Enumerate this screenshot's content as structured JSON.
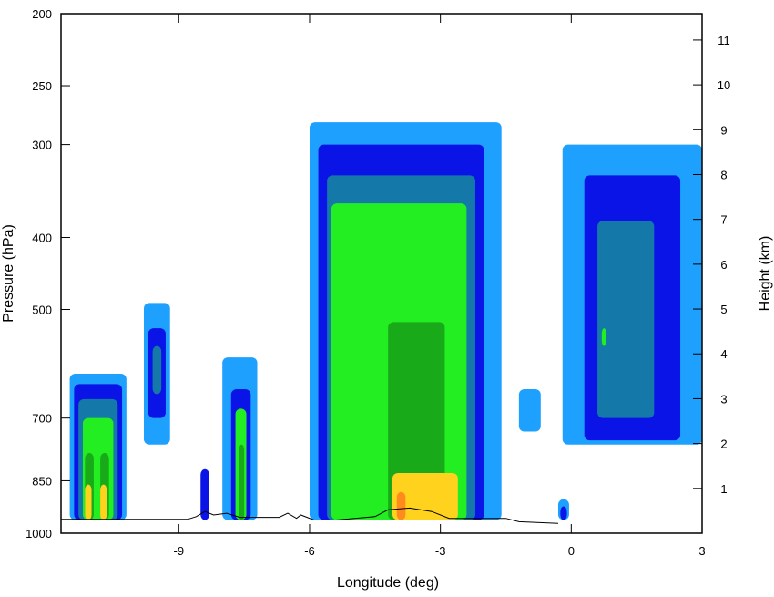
{
  "chart_data": {
    "type": "heatmap",
    "title": "",
    "xlabel": "Longitude (deg)",
    "ylabel": "Pressure (hPa)",
    "ylabel_right": "Height (km)",
    "xlim": [
      -11.7,
      3.0
    ],
    "ylim_pressure": [
      1000,
      200
    ],
    "y_scale": "log",
    "grid": false,
    "x_ticks": [
      {
        "value": -9,
        "label": "-9"
      },
      {
        "value": -6,
        "label": "-6"
      },
      {
        "value": -3,
        "label": "-3"
      },
      {
        "value": 0,
        "label": "0"
      },
      {
        "value": 3,
        "label": "3"
      }
    ],
    "y_ticks": [
      {
        "value": 200,
        "label": "200"
      },
      {
        "value": 250,
        "label": "250"
      },
      {
        "value": 300,
        "label": "300"
      },
      {
        "value": 400,
        "label": "400"
      },
      {
        "value": 500,
        "label": "500"
      },
      {
        "value": 700,
        "label": "700"
      },
      {
        "value": 850,
        "label": "850"
      },
      {
        "value": 1000,
        "label": "1000"
      }
    ],
    "height_ticks": [
      {
        "value": 1,
        "label": "1"
      },
      {
        "value": 2,
        "label": "2"
      },
      {
        "value": 3,
        "label": "3"
      },
      {
        "value": 4,
        "label": "4"
      },
      {
        "value": 5,
        "label": "5"
      },
      {
        "value": 6,
        "label": "6"
      },
      {
        "value": 7,
        "label": "7"
      },
      {
        "value": 8,
        "label": "8"
      },
      {
        "value": 9,
        "label": "9"
      },
      {
        "value": 10,
        "label": "10"
      },
      {
        "value": 11,
        "label": "11"
      }
    ],
    "colors": {
      "level1": "#1ea0ff",
      "level2": "#0a14e6",
      "level3": "#1478a8",
      "level4": "#22ee22",
      "level5": "#18aa18",
      "level6": "#ffd21e",
      "level7": "#ff8a1e",
      "terrain_line": "#000000"
    },
    "cells": [
      {
        "x": [
          -11.5,
          -10.2
        ],
        "p": [
          610,
          960
        ],
        "level": 1
      },
      {
        "x": [
          -11.4,
          -10.3
        ],
        "p": [
          630,
          960
        ],
        "level": 2
      },
      {
        "x": [
          -11.3,
          -10.4
        ],
        "p": [
          660,
          960
        ],
        "level": 3
      },
      {
        "x": [
          -11.2,
          -10.5
        ],
        "p": [
          700,
          960
        ],
        "level": 4
      },
      {
        "x": [
          -11.15,
          -10.95
        ],
        "p": [
          780,
          960
        ],
        "level": 5
      },
      {
        "x": [
          -10.8,
          -10.6
        ],
        "p": [
          780,
          960
        ],
        "level": 5
      },
      {
        "x": [
          -11.15,
          -11.0
        ],
        "p": [
          860,
          960
        ],
        "level": 6
      },
      {
        "x": [
          -10.8,
          -10.65
        ],
        "p": [
          860,
          960
        ],
        "level": 6
      },
      {
        "x": [
          -9.8,
          -9.2
        ],
        "p": [
          490,
          760
        ],
        "level": 1
      },
      {
        "x": [
          -9.7,
          -9.3
        ],
        "p": [
          530,
          700
        ],
        "level": 2
      },
      {
        "x": [
          -9.6,
          -9.4
        ],
        "p": [
          560,
          650
        ],
        "level": 3
      },
      {
        "x": [
          -8.5,
          -8.3
        ],
        "p": [
          820,
          960
        ],
        "level": 2
      },
      {
        "x": [
          -8.0,
          -7.2
        ],
        "p": [
          580,
          960
        ],
        "level": 1
      },
      {
        "x": [
          -7.8,
          -7.35
        ],
        "p": [
          640,
          960
        ],
        "level": 2
      },
      {
        "x": [
          -7.7,
          -7.45
        ],
        "p": [
          680,
          960
        ],
        "level": 4
      },
      {
        "x": [
          -7.62,
          -7.5
        ],
        "p": [
          760,
          960
        ],
        "level": 5
      },
      {
        "x": [
          -6.0,
          -1.6
        ],
        "p": [
          280,
          960
        ],
        "level": 1
      },
      {
        "x": [
          -5.8,
          -2.0
        ],
        "p": [
          300,
          960
        ],
        "level": 2
      },
      {
        "x": [
          -5.6,
          -2.2
        ],
        "p": [
          330,
          960
        ],
        "level": 3
      },
      {
        "x": [
          -5.5,
          -2.4
        ],
        "p": [
          360,
          960
        ],
        "level": 4
      },
      {
        "x": [
          -4.2,
          -2.9
        ],
        "p": [
          520,
          960
        ],
        "level": 5
      },
      {
        "x": [
          -4.1,
          -2.6
        ],
        "p": [
          830,
          960
        ],
        "level": 6
      },
      {
        "x": [
          -4.0,
          -3.8
        ],
        "p": [
          880,
          960
        ],
        "level": 7
      },
      {
        "x": [
          -1.2,
          -0.7
        ],
        "p": [
          640,
          730
        ],
        "level": 1
      },
      {
        "x": [
          -0.3,
          -0.05
        ],
        "p": [
          900,
          960
        ],
        "level": 1
      },
      {
        "x": [
          -0.25,
          -0.1
        ],
        "p": [
          920,
          960
        ],
        "level": 2
      },
      {
        "x": [
          -0.2,
          3.0
        ],
        "p": [
          300,
          760
        ],
        "level": 1
      },
      {
        "x": [
          0.3,
          2.5
        ],
        "p": [
          330,
          750
        ],
        "level": 2
      },
      {
        "x": [
          0.6,
          1.9
        ],
        "p": [
          380,
          700
        ],
        "level": 3
      },
      {
        "x": [
          0.7,
          0.8
        ],
        "p": [
          530,
          560
        ],
        "level": 4
      }
    ],
    "terrain": [
      {
        "x": -11.7,
        "p": 958
      },
      {
        "x": -8.8,
        "p": 958
      },
      {
        "x": -8.6,
        "p": 950
      },
      {
        "x": -8.4,
        "p": 935
      },
      {
        "x": -8.2,
        "p": 945
      },
      {
        "x": -7.9,
        "p": 940
      },
      {
        "x": -7.6,
        "p": 952
      },
      {
        "x": -6.7,
        "p": 952
      },
      {
        "x": -6.5,
        "p": 940
      },
      {
        "x": -6.3,
        "p": 955
      },
      {
        "x": -6.2,
        "p": 945
      },
      {
        "x": -5.9,
        "p": 960
      },
      {
        "x": -5.4,
        "p": 960
      },
      {
        "x": -4.5,
        "p": 950
      },
      {
        "x": -4.2,
        "p": 930
      },
      {
        "x": -3.7,
        "p": 925
      },
      {
        "x": -3.2,
        "p": 935
      },
      {
        "x": -2.8,
        "p": 955
      },
      {
        "x": -1.5,
        "p": 955
      },
      {
        "x": -1.2,
        "p": 965
      },
      {
        "x": -0.3,
        "p": 970
      }
    ]
  }
}
